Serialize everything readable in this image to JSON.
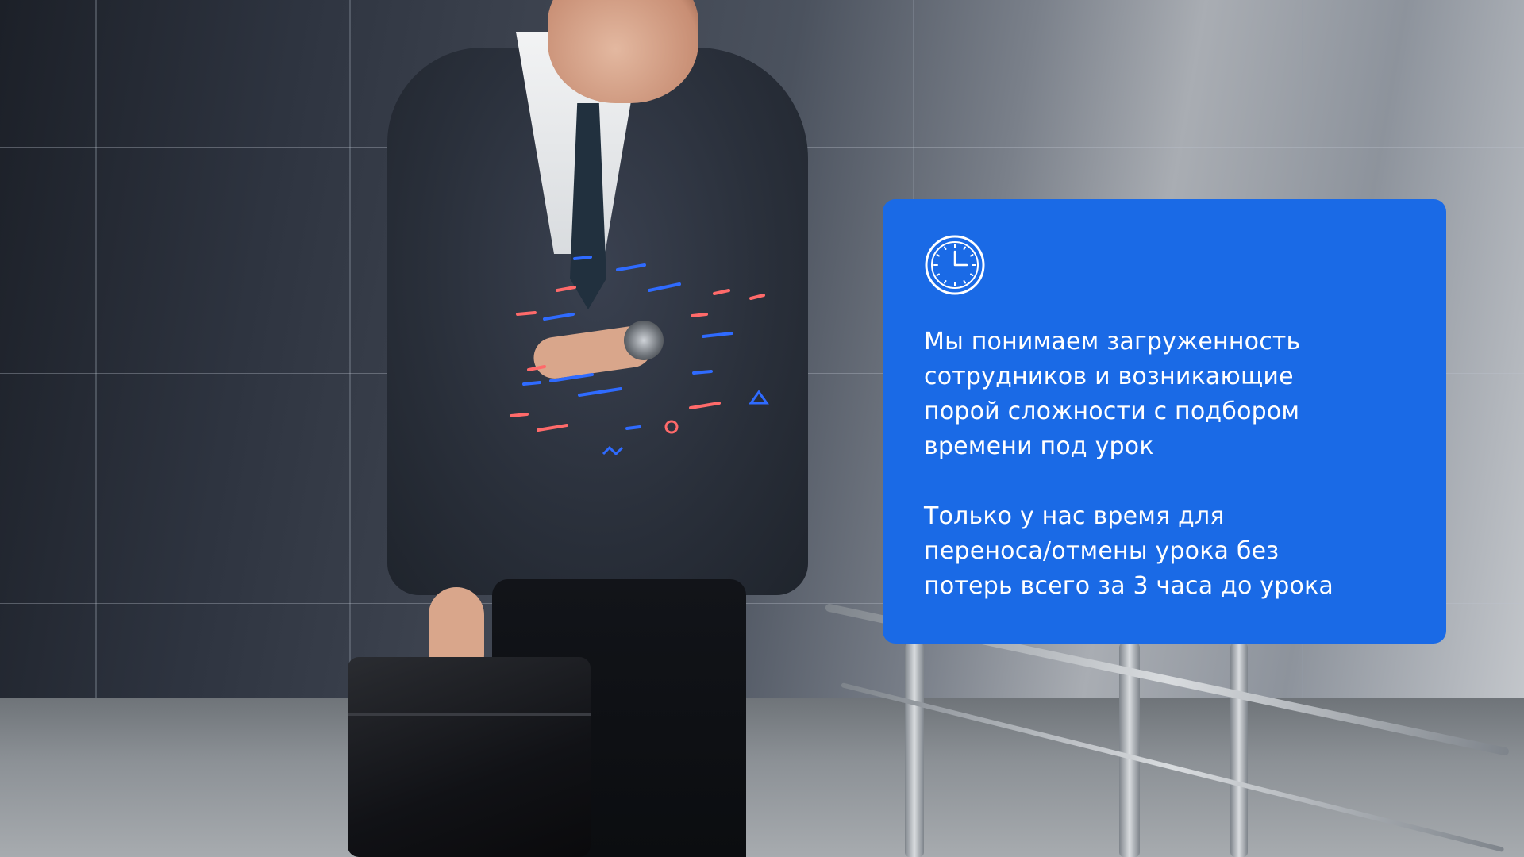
{
  "slide": {
    "card": {
      "icon": "clock-icon",
      "paragraph_1": "Мы понимаем загруженность\nсотрудников и возникающие\nпорой сложности с подбором\nвремени под урок",
      "paragraph_2": "Только у нас время для\nпереноса/отмены урока без\nпотерь всего за 3 часа до урока"
    }
  },
  "colors": {
    "card_background": "#1a6ae6",
    "card_text": "#ffffff",
    "glitch_red": "#ff6a6a",
    "glitch_blue": "#2f6bff"
  }
}
